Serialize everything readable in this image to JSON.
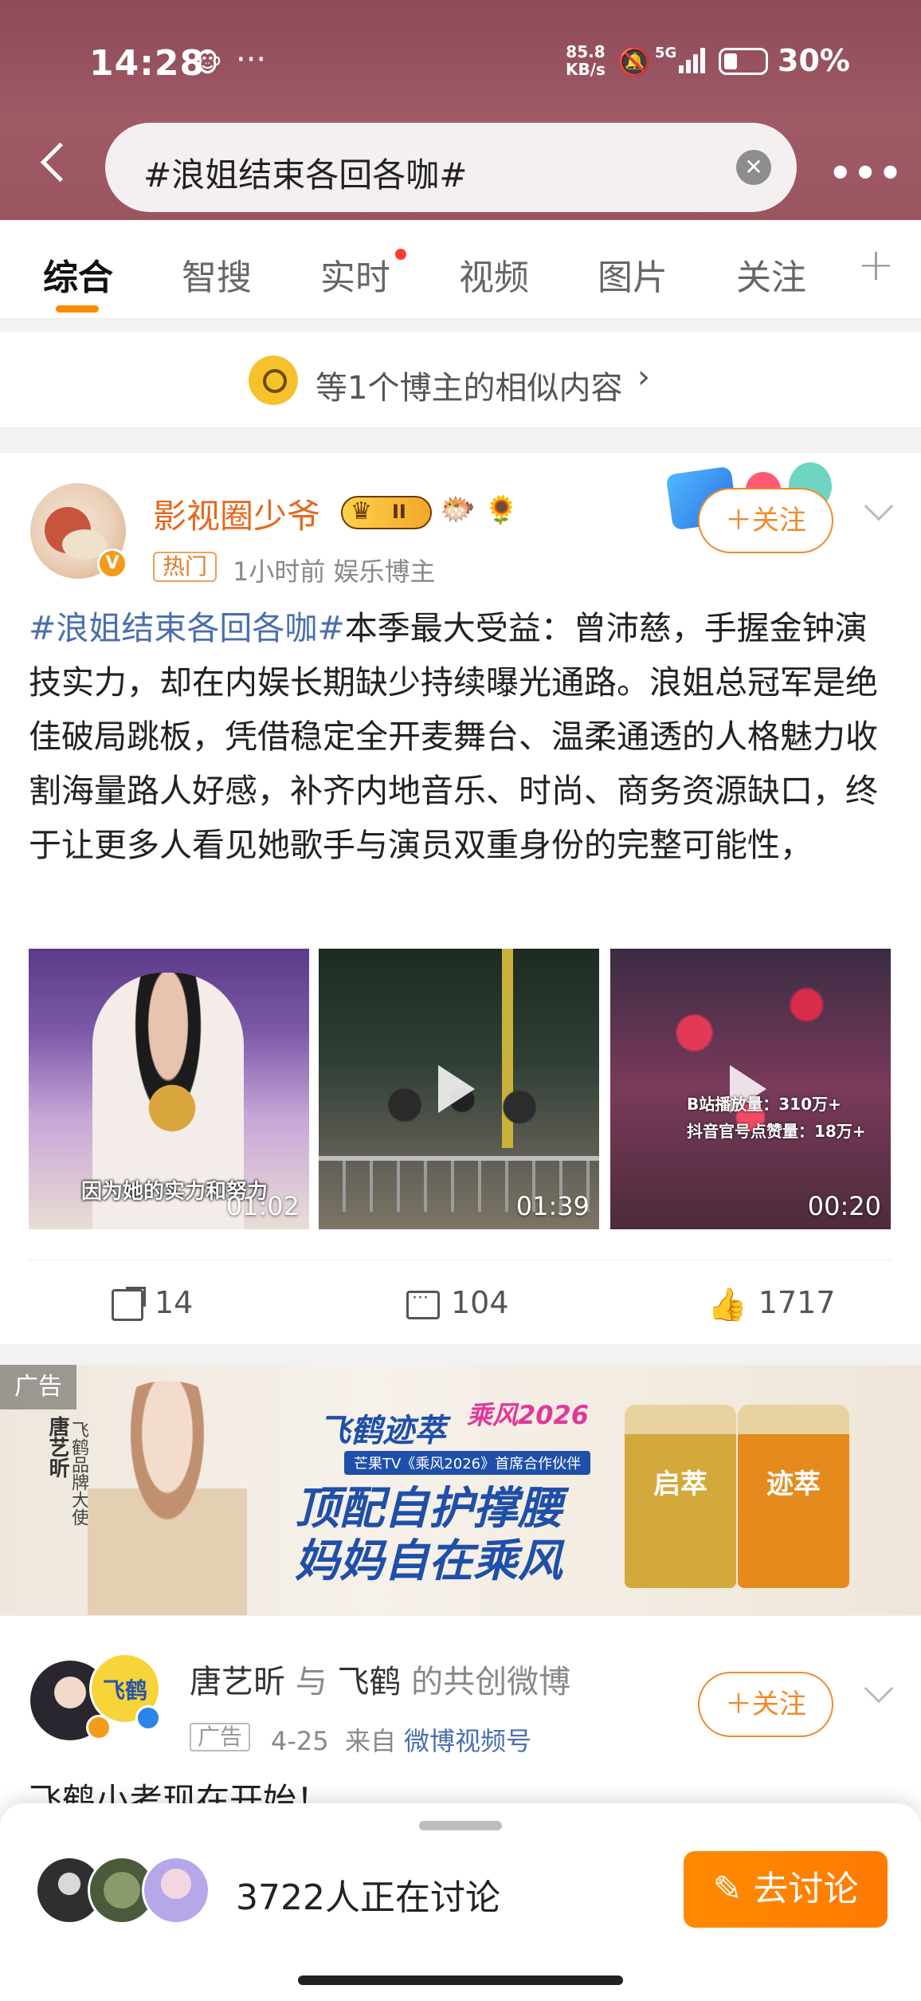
{
  "status_bar": {
    "time": "14:28",
    "emoji": "🐵",
    "dots": "···",
    "speed_line1": "85.8",
    "speed_line2": "KB/s",
    "network": "5G",
    "battery": "30%"
  },
  "search": {
    "query": "#浪姐结束各回各咖#",
    "clear_glyph": "✕",
    "more_glyph": "•••"
  },
  "tabs": {
    "items": [
      "综合",
      "智搜",
      "实时",
      "视频",
      "图片",
      "关注"
    ],
    "active_index": 0,
    "plus": "+"
  },
  "similar": {
    "text": "等1个博主的相似内容",
    "chevron": "›"
  },
  "post": {
    "user_name": "影视圈少爷",
    "level": "II",
    "deco1": "🐡",
    "deco2": "🌻",
    "v_badge": "V",
    "hot_badge": "热门",
    "meta": "1小时前   娱乐博主",
    "follow": "＋关注",
    "hashtag": "#浪姐结束各回各咖#",
    "body": "本季最大受益：曾沛慈，手握金钟演技实力，却在内娱长期缺少持续曝光通路。浪姐总冠军是绝佳破局跳板，凭借稳定全开麦舞台、温柔通透的人格魅力收割海量路人好感，补齐内地音乐、时尚、商务资源缺口，终于让更多人看见她歌手与演员双重身份的完整可能性，",
    "media": [
      {
        "duration": "01:02",
        "subtitle": "因为她的实力和努力"
      },
      {
        "duration": "01:39"
      },
      {
        "duration": "00:20",
        "stats_line1": "B站播放量：310万+",
        "stats_line2": "抖音官号点赞量：18万+"
      }
    ],
    "shares": "14",
    "comments": "104",
    "likes": "1717"
  },
  "ad_banner": {
    "label": "广告",
    "ambassador_name": "唐艺昕",
    "ambassador_title": "飞鹤品牌大使",
    "brand": "飞鹤迹萃",
    "campaign": "乘风2026",
    "sponsor_line": "芒果TV《乘风2026》首席合作伙伴",
    "slogan_line1": "顶配自护撑腰",
    "slogan_line2": "妈妈自在乘风",
    "product1": "启萃",
    "product2": "迹萃"
  },
  "post2": {
    "author1": "唐艺昕",
    "connector": "与",
    "author2": "飞鹤",
    "suffix": "的共创微博",
    "avatar_text": "飞鹤",
    "ad_badge": "广告",
    "date": "4-25",
    "from_label": "来自",
    "source": "微博视频号",
    "follow": "＋关注",
    "text": "飞鹤小考现在开始！"
  },
  "bottom_sheet": {
    "discuss_count": "3722人正在讨论",
    "discuss_button": "✎ 去讨论"
  },
  "colors": {
    "accent": "#ff8a00",
    "link": "#4a6fae",
    "username": "#e5681e",
    "header_bg": "#9b5561"
  }
}
